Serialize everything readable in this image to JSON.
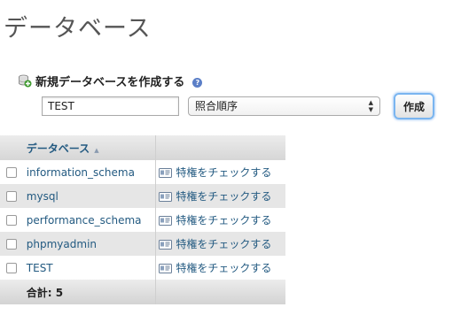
{
  "page": {
    "title": "データベース"
  },
  "create": {
    "label": "新規データベースを作成する",
    "help_icon": "?",
    "dbname_value": "TEST",
    "collation_value": "照合順序",
    "button_label": "作成",
    "arrows": "▲▼"
  },
  "table": {
    "header": {
      "name": "データベース",
      "sort_icon": "▲"
    },
    "rows": [
      {
        "name": "information_schema",
        "action": "特権をチェックする"
      },
      {
        "name": "mysql",
        "action": "特権をチェックする"
      },
      {
        "name": "performance_schema",
        "action": "特権をチェックする"
      },
      {
        "name": "phpmyadmin",
        "action": "特権をチェックする"
      },
      {
        "name": "TEST",
        "action": "特権をチェックする"
      }
    ],
    "total_label": "合計: 5"
  },
  "colors": {
    "link": "#235a81",
    "button_focus": "#7ab5f0",
    "row_alt": "#e6e6e6"
  },
  "icons": [
    "database-add-icon",
    "help-icon",
    "sort-asc-icon",
    "privileges-icon",
    "checkbox"
  ]
}
